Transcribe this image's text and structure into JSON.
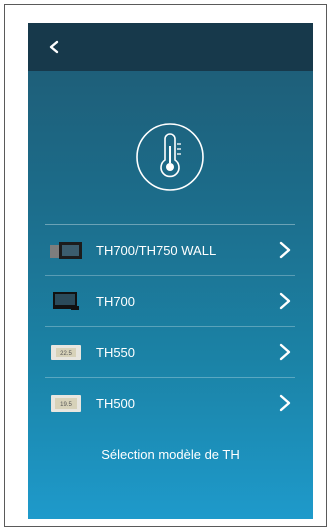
{
  "header": {
    "back_icon": "chevron-left-icon"
  },
  "hero_icon": "thermometer-icon",
  "models": [
    {
      "label": "TH700/TH750 WALL",
      "icon": "dual-thermostat-icon"
    },
    {
      "label": "TH700",
      "icon": "black-thermostat-icon"
    },
    {
      "label": "TH550",
      "icon": "white-thermostat-icon"
    },
    {
      "label": "TH500",
      "icon": "white-thermostat-icon"
    }
  ],
  "footer": {
    "caption": "Sélection modèle de TH"
  },
  "colors": {
    "topbar": "#17394b",
    "gradient_top": "#1f5a73",
    "gradient_bottom": "#1e9acb"
  }
}
